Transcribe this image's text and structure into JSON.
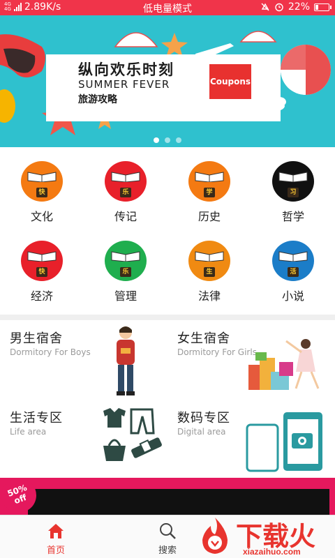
{
  "status_bar": {
    "network_tag": "4G\n4G",
    "speed": "2.89K/s",
    "mode": "低电量模式",
    "battery_percent": "22%",
    "battery_level": 0.22,
    "icons": [
      "signal-icon",
      "mute-icon",
      "alarm-icon",
      "battery-icon"
    ]
  },
  "banner": {
    "title": "纵向欢乐时刻",
    "subtitle": "SUMMER FEVER",
    "guide": "旅游攻略",
    "coupon": "Coupons",
    "page_count": 3,
    "active_page": 1
  },
  "categories": [
    {
      "label": "文化",
      "tag": "快",
      "color": "#f47a12"
    },
    {
      "label": "传记",
      "tag": "乐",
      "color": "#e8202a"
    },
    {
      "label": "历史",
      "tag": "学",
      "color": "#f47a12"
    },
    {
      "label": "哲学",
      "tag": "习",
      "color": "#111111"
    },
    {
      "label": "经济",
      "tag": "快",
      "color": "#e8202a"
    },
    {
      "label": "管理",
      "tag": "乐",
      "color": "#1fae4e"
    },
    {
      "label": "法律",
      "tag": "生",
      "color": "#f08a12"
    },
    {
      "label": "小说",
      "tag": "活",
      "color": "#1b7dc8"
    }
  ],
  "areas": {
    "boys": {
      "title": "男生宿舍",
      "subtitle": "Dormitory For Boys"
    },
    "girls": {
      "title": "女生宿舍",
      "subtitle": "Dormitory For Girls"
    },
    "life": {
      "title": "生活专区",
      "subtitle": "Life area"
    },
    "digital": {
      "title": "数码专区",
      "subtitle": "Digital area"
    }
  },
  "promo": {
    "badge_line1": "50%",
    "badge_line2": "off"
  },
  "tabbar": {
    "home": "首页",
    "search": "搜索",
    "accent": "#e8342e"
  },
  "watermark": {
    "text": "下载火",
    "sub": "xiazaihuo.com"
  }
}
